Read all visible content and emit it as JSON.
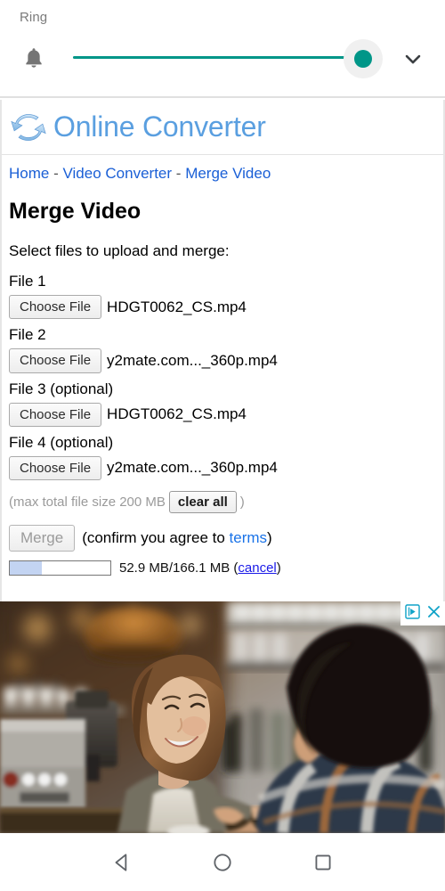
{
  "volume_panel": {
    "label": "Ring",
    "bell_icon": "bell-icon",
    "chevron_icon": "chevron-down-icon",
    "slider_value_percent": 97,
    "accent_color": "#009688",
    "track_color": "#d8d8d8"
  },
  "site": {
    "logo_icon": "refresh-arrows-logo-icon",
    "title": "Online Converter",
    "title_color": "#5a9fe0",
    "breadcrumb": [
      {
        "label": "Home"
      },
      {
        "label": "Video Converter"
      },
      {
        "label": "Merge Video"
      }
    ],
    "breadcrumb_separator": "-",
    "link_color": "#1a5fd6"
  },
  "main": {
    "page_title": "Merge Video",
    "intro": "Select files to upload and merge:",
    "choose_file_label": "Choose File",
    "files": [
      {
        "label": "File 1",
        "value": "HDGT0062_CS.mp4"
      },
      {
        "label": "File 2",
        "value": "y2mate.com..._360p.mp4"
      },
      {
        "label": "File 3 (optional)",
        "value": "HDGT0062_CS.mp4"
      },
      {
        "label": "File 4 (optional)",
        "value": "y2mate.com..._360p.mp4"
      }
    ],
    "max_size_prefix": "(max total file size 200 MB",
    "clear_all_label": "clear all",
    "max_size_suffix": ")",
    "merge_label": "Merge",
    "confirm_prefix": "(confirm you agree to ",
    "terms_label": "terms",
    "confirm_suffix": ")",
    "progress": {
      "percent": 32,
      "uploaded": "52.9 MB",
      "total": "166.1 MB",
      "text": "52.9 MB/166.1 MB (",
      "cancel_label": "cancel",
      "text_suffix": ")",
      "fill_color": "#c3d4f2"
    }
  },
  "ad": {
    "adchoices_icon": "adchoices-icon",
    "close_icon": "close-icon",
    "icon_color": "#11a3c8",
    "description": "Barista woman in apron smiling while handing a card to a customer in a plaid shirt at a coffee shop counter"
  },
  "navbar": {
    "back_icon": "back-triangle-icon",
    "home_icon": "home-circle-icon",
    "recents_icon": "recents-square-icon",
    "icon_color": "#5f6368"
  }
}
